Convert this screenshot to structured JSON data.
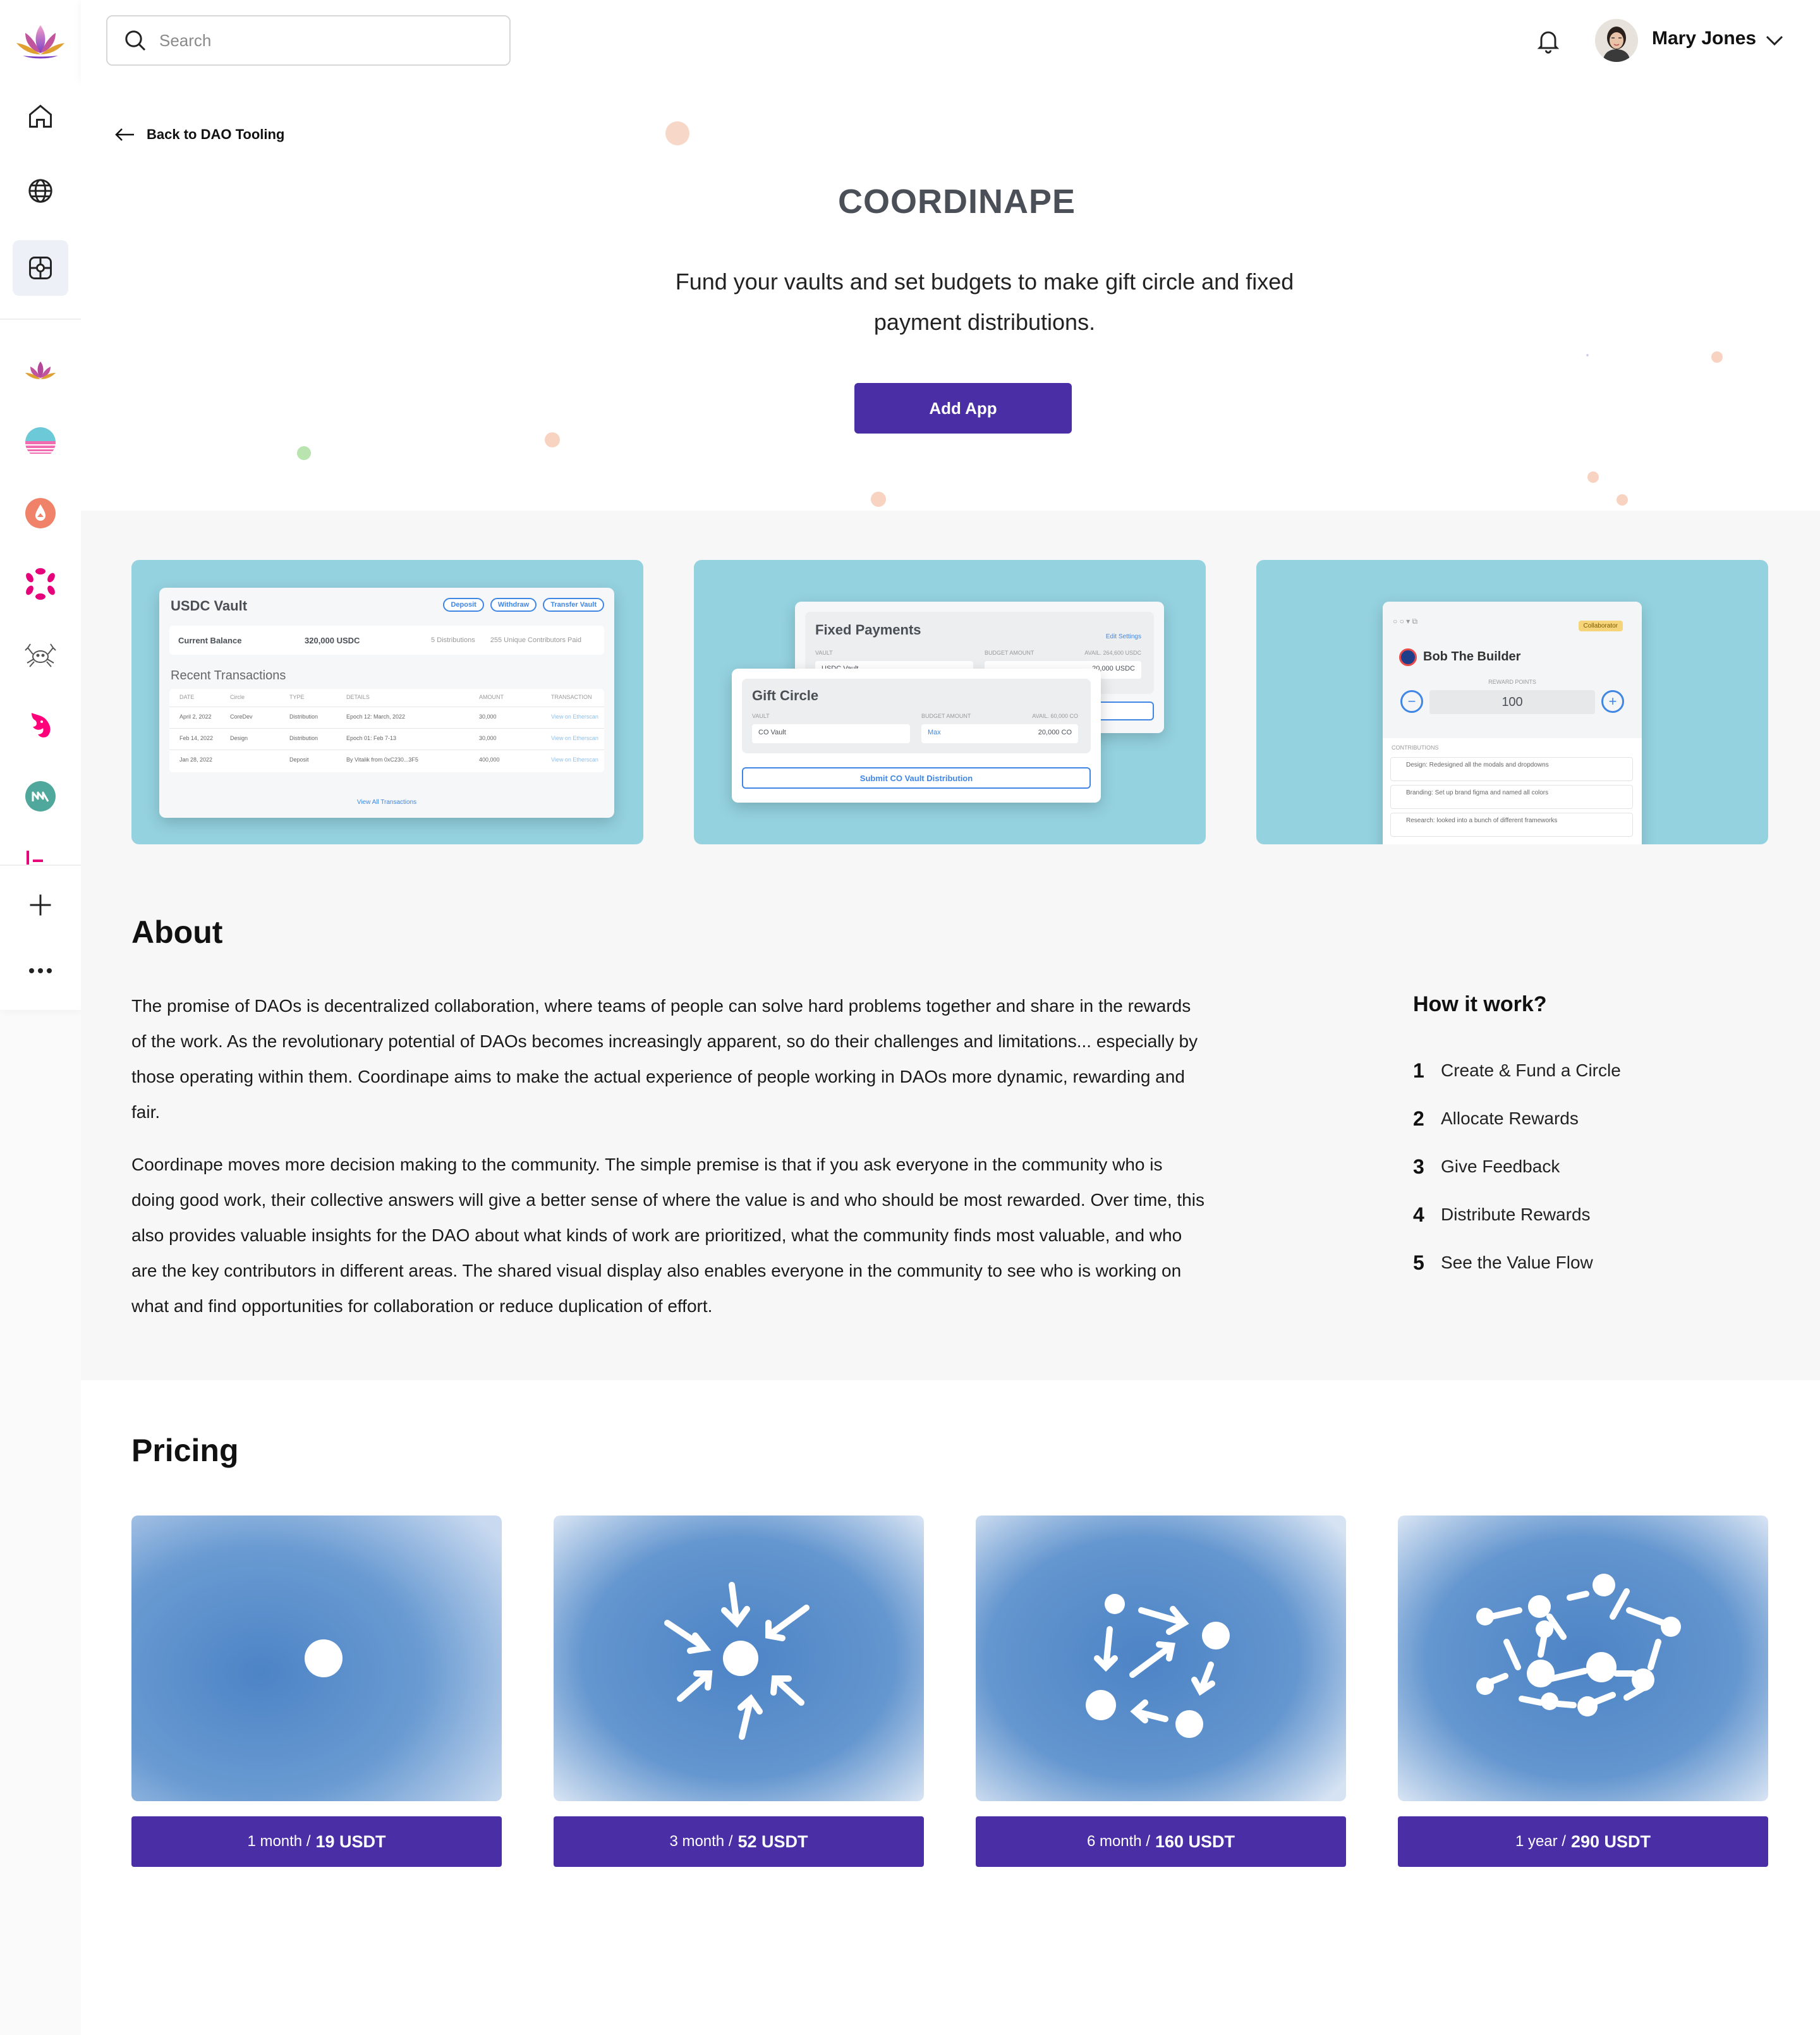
{
  "search": {
    "placeholder": "Search"
  },
  "user": {
    "name": "Mary Jones"
  },
  "back_link": {
    "label": "Back to DAO Tooling"
  },
  "app": {
    "title": "COORDINAPE",
    "subtitle": "Fund your vaults and set budgets to make gift circle and fixed payment distributions.",
    "add_button": "Add App"
  },
  "sidebar": {
    "nav": [
      {
        "icon": "home-icon"
      },
      {
        "icon": "globe-icon"
      },
      {
        "icon": "apps-grid-icon",
        "active": true
      }
    ],
    "apps": [
      "lotus-app-icon",
      "sunset-app-icon",
      "drop-app-icon",
      "polkadot-app-icon",
      "crab-app-icon",
      "unicorn-app-icon",
      "maker-app-icon",
      "partial-app-icon"
    ],
    "add_icon": "plus-icon",
    "more_icon": "more-dots-icon"
  },
  "screenshots": {
    "vault": {
      "title": "USDC Vault",
      "buttons": [
        "Deposit",
        "Withdraw",
        "Transfer Vault"
      ],
      "balance_label": "Current Balance",
      "balance_value": "320,000 USDC",
      "distributions_count": "5",
      "distributions_label": "Distributions",
      "contributors_count": "255",
      "contributors_label": "Unique Contributors Paid",
      "recent_label": "Recent Transactions",
      "columns": [
        "DATE",
        "Circle",
        "TYPE",
        "DETAILS",
        "AMOUNT",
        "TRANSACTION"
      ],
      "rows": [
        [
          "April 2, 2022",
          "CoreDev",
          "Distribution",
          "Epoch 12: March, 2022",
          "30,000",
          "View on Etherscan"
        ],
        [
          "Feb 14, 2022",
          "Design",
          "Distribution",
          "Epoch 01: Feb 7-13",
          "30,000",
          "View on Etherscan"
        ],
        [
          "Jan 28, 2022",
          "",
          "Deposit",
          "By Vitalik from 0xC230...3F5",
          "400,000",
          "View on Etherscan"
        ]
      ],
      "view_all": "View All Transactions"
    },
    "payments": {
      "fixed_title": "Fixed Payments",
      "edit_settings": "Edit Settings",
      "vault_label": "VAULT",
      "budget_label": "BUDGET AMOUNT",
      "fixed_avail": "AVAIL. 264,600 USDC",
      "fixed_vault": "USDC Vault",
      "fixed_amount": "20,000",
      "fixed_currency": "USDC",
      "gift_title": "Gift Circle",
      "gift_avail": "AVAIL. 60,000 CO",
      "gift_vault": "CO Vault",
      "gift_max": "Max",
      "gift_amount": "20,000",
      "gift_currency": "CO",
      "submit": "Submit CO Vault Distribution"
    },
    "rewards": {
      "badge": "Collaborator",
      "name": "Bob The Builder",
      "points_label": "REWARD POINTS",
      "points": "100",
      "contributions_label": "CONTRIBUTIONS",
      "contributions": [
        "Design: Redesigned all the modals and dropdowns",
        "Branding: Set up brand figma and named all colors",
        "Research: looked into a bunch of different frameworks"
      ]
    }
  },
  "about": {
    "heading": "About",
    "paragraphs": [
      "The promise of DAOs is decentralized collaboration, where teams of people can solve hard problems together and share in the rewards of the work. As the revolutionary potential of DAOs becomes increasingly apparent, so do their challenges and limitations... especially by those operating within them. Coordinape aims to make the actual experience of people working in DAOs more dynamic, rewarding and fair.",
      "Coordinape moves more decision making to the community. The simple premise is that if you ask everyone in the community who is doing good work, their collective answers will give a better sense of where the value is and who should be most rewarded. Over time, this also provides valuable insights for the DAO about what kinds of work are prioritized, what the community finds most valuable, and who are the key contributors in different areas. The shared visual display also enables everyone in the community to see who is working on what and find opportunities for collaboration or reduce duplication of effort."
    ]
  },
  "how_it_works": {
    "heading": "How it work?",
    "steps": [
      {
        "n": "1",
        "text": "Create & Fund a Circle"
      },
      {
        "n": "2",
        "text": "Allocate Rewards"
      },
      {
        "n": "3",
        "text": "Give Feedback"
      },
      {
        "n": "4",
        "text": "Distribute Rewards"
      },
      {
        "n": "5",
        "text": "See the Value Flow"
      }
    ]
  },
  "pricing": {
    "heading": "Pricing",
    "plans": [
      {
        "period": "1 month /",
        "price": "19 USDT",
        "image": "single-dot-illustration"
      },
      {
        "period": "3 month /",
        "price": "52 USDT",
        "image": "converging-arrows-illustration"
      },
      {
        "period": "6 month /",
        "price": "160 USDT",
        "image": "flow-arrows-illustration"
      },
      {
        "period": "1 year /",
        "price": "290 USDT",
        "image": "network-illustration"
      }
    ]
  },
  "colors": {
    "accent": "#4a2ea5",
    "title_gray": "#4b4f58",
    "screenshot_bg": "#94d2e0",
    "pricing_blue": "#5a8fcc"
  }
}
